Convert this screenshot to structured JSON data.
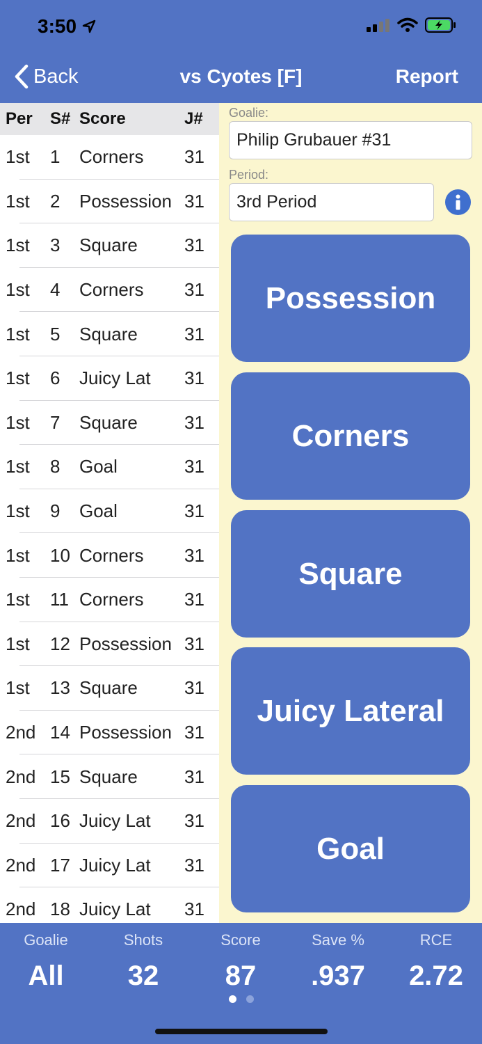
{
  "status": {
    "time": "3:50"
  },
  "nav": {
    "back_label": "Back",
    "title": "vs Cyotes [F]",
    "report_label": "Report"
  },
  "table": {
    "headers": {
      "per": "Per",
      "shot": "S#",
      "score": "Score",
      "jersey": "J#"
    },
    "rows": [
      {
        "per": "1st",
        "shot": "1",
        "score": "Corners",
        "jersey": "31"
      },
      {
        "per": "1st",
        "shot": "2",
        "score": "Possession",
        "jersey": "31"
      },
      {
        "per": "1st",
        "shot": "3",
        "score": "Square",
        "jersey": "31"
      },
      {
        "per": "1st",
        "shot": "4",
        "score": "Corners",
        "jersey": "31"
      },
      {
        "per": "1st",
        "shot": "5",
        "score": "Square",
        "jersey": "31"
      },
      {
        "per": "1st",
        "shot": "6",
        "score": "Juicy Lat",
        "jersey": "31"
      },
      {
        "per": "1st",
        "shot": "7",
        "score": "Square",
        "jersey": "31"
      },
      {
        "per": "1st",
        "shot": "8",
        "score": "Goal",
        "jersey": "31"
      },
      {
        "per": "1st",
        "shot": "9",
        "score": "Goal",
        "jersey": "31"
      },
      {
        "per": "1st",
        "shot": "10",
        "score": "Corners",
        "jersey": "31"
      },
      {
        "per": "1st",
        "shot": "11",
        "score": "Corners",
        "jersey": "31"
      },
      {
        "per": "1st",
        "shot": "12",
        "score": "Possession",
        "jersey": "31"
      },
      {
        "per": "1st",
        "shot": "13",
        "score": "Square",
        "jersey": "31"
      },
      {
        "per": "2nd",
        "shot": "14",
        "score": "Possession",
        "jersey": "31"
      },
      {
        "per": "2nd",
        "shot": "15",
        "score": "Square",
        "jersey": "31"
      },
      {
        "per": "2nd",
        "shot": "16",
        "score": "Juicy Lat",
        "jersey": "31"
      },
      {
        "per": "2nd",
        "shot": "17",
        "score": "Juicy Lat",
        "jersey": "31"
      },
      {
        "per": "2nd",
        "shot": "18",
        "score": "Juicy Lat",
        "jersey": "31"
      }
    ]
  },
  "form": {
    "goalie_label": "Goalie:",
    "goalie_value": "Philip Grubauer #31",
    "period_label": "Period:",
    "period_value": "3rd Period"
  },
  "actions": [
    "Possession",
    "Corners",
    "Square",
    "Juicy Lateral",
    "Goal"
  ],
  "stats": [
    {
      "label": "Goalie",
      "value": "All"
    },
    {
      "label": "Shots",
      "value": "32"
    },
    {
      "label": "Score",
      "value": "87"
    },
    {
      "label": "Save %",
      "value": ".937"
    },
    {
      "label": "RCE",
      "value": "2.72"
    }
  ],
  "colors": {
    "primary": "#5273C4",
    "panel_bg": "#FBF6CF",
    "header_bg": "#E6E6E8",
    "battery": "#4CD964"
  }
}
